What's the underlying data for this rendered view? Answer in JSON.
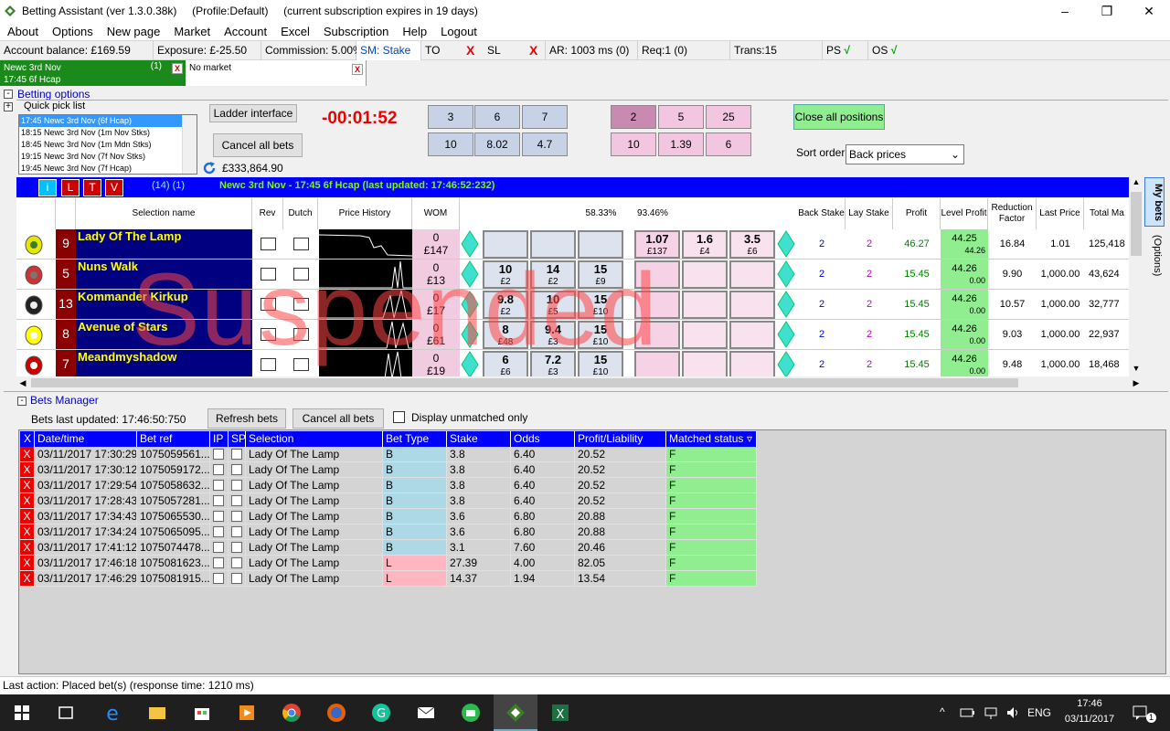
{
  "window": {
    "title": "Betting Assistant (ver 1.3.0.38k)     (Profile:Default)     (current subscription expires in 19 days)",
    "controls": [
      "–",
      "❐",
      "✕"
    ]
  },
  "menu": [
    "About",
    "Options",
    "New page",
    "Market",
    "Account",
    "Excel",
    "Subscription",
    "Help",
    "Logout"
  ],
  "status": {
    "balance": "Account balance: £169.59",
    "exposure": "Exposure: £-25.50",
    "commission": "Commission: 5.00%",
    "sm": "SM: Stake",
    "to": "TO",
    "sl": "SL",
    "x": "X",
    "ar": "AR: 1003 ms (0)",
    "req": "Req:1 (0)",
    "trans": "Trans:15",
    "ps": "PS",
    "os": "OS",
    "check": "√"
  },
  "market_tabs": [
    {
      "line1": "Newc 3rd Nov",
      "line2": "17:45 6f Hcap",
      "count": "(1)",
      "close": "X"
    },
    {
      "line1": "No market",
      "line2": "",
      "count": "",
      "close": "X"
    }
  ],
  "betting_options": {
    "label": "Betting options",
    "quick_pick_label": "Quick pick list",
    "quick_pick": [
      "17:45 Newc 3rd Nov (6f Hcap)",
      "18:15 Newc 3rd Nov (1m Nov Stks)",
      "18:45 Newc 3rd Nov (1m Mdn Stks)",
      "19:15 Newc 3rd Nov (7f Nov Stks)",
      "19:45 Newc 3rd Nov (7f Hcap)"
    ],
    "ladder_btn": "Ladder interface",
    "cancel_all_btn": "Cancel all bets",
    "timer": "-00:01:52",
    "total_matched": "£333,864.90",
    "back_stakes": [
      "3",
      "6",
      "7",
      "10",
      "8.02",
      "4.7"
    ],
    "lay_stakes": [
      "2",
      "5",
      "25",
      "10",
      "1.39",
      "6"
    ],
    "close_all_btn": "Close all positions",
    "sort_label": "Sort order",
    "sort_value": "Back prices"
  },
  "market_bar": {
    "buttons": [
      "i",
      "L",
      "T",
      "V"
    ],
    "count": "(14) (1)",
    "title": "Newc 3rd Nov - 17:45 6f Hcap (last updated: 17:46:52:232)"
  },
  "grid_headers": {
    "selection": "Selection name",
    "rev": "Rev",
    "dutch": "Dutch",
    "price_history": "Price History",
    "wom": "WOM",
    "back_pct": "58.33%",
    "lay_pct": "93.46%",
    "back_stake": "Back Stake",
    "lay_stake": "Lay Stake",
    "profit": "Profit",
    "level_profit": "Level Profit",
    "reduction": "Reduction Factor",
    "last_price": "Last Price",
    "total_matched": "Total Ma"
  },
  "runners": [
    {
      "num": "9",
      "name": "Lady Of The Lamp",
      "wom_top": "0",
      "wom_bot": "£147",
      "back": [
        {
          "p": "",
          "s": ""
        },
        {
          "p": "",
          "s": ""
        },
        {
          "p": "",
          "s": ""
        }
      ],
      "lay": [
        {
          "p": "1.07",
          "s": "£137"
        },
        {
          "p": "1.6",
          "s": "£4"
        },
        {
          "p": "3.5",
          "s": "£6"
        }
      ],
      "back_stake": "2",
      "lay_stake": "2",
      "profit": "46.27",
      "level": "44.25",
      "level_sub": "44.26",
      "reduction": "16.84",
      "last": "1.01",
      "total": "125,418"
    },
    {
      "num": "5",
      "name": "Nuns Walk",
      "wom_top": "0",
      "wom_bot": "£13",
      "back": [
        {
          "p": "10",
          "s": "£2"
        },
        {
          "p": "14",
          "s": "£2"
        },
        {
          "p": "15",
          "s": "£9"
        }
      ],
      "lay": [
        {
          "p": "",
          "s": ""
        },
        {
          "p": "",
          "s": ""
        },
        {
          "p": "",
          "s": ""
        }
      ],
      "back_stake": "2",
      "lay_stake": "2",
      "profit": "15.45",
      "level": "44.26",
      "level_sub": "0.00",
      "reduction": "9.90",
      "last": "1,000.00",
      "total": "43,624"
    },
    {
      "num": "13",
      "name": "Kommander Kirkup",
      "wom_top": "0",
      "wom_bot": "£17",
      "back": [
        {
          "p": "9.8",
          "s": "£2"
        },
        {
          "p": "10",
          "s": "£5"
        },
        {
          "p": "15",
          "s": "£10"
        }
      ],
      "lay": [
        {
          "p": "",
          "s": ""
        },
        {
          "p": "",
          "s": ""
        },
        {
          "p": "",
          "s": ""
        }
      ],
      "back_stake": "2",
      "lay_stake": "2",
      "profit": "15.45",
      "level": "44.26",
      "level_sub": "0.00",
      "reduction": "10.57",
      "last": "1,000.00",
      "total": "32,777"
    },
    {
      "num": "8",
      "name": "Avenue of Stars",
      "wom_top": "0",
      "wom_bot": "£61",
      "back": [
        {
          "p": "8",
          "s": "£48"
        },
        {
          "p": "9.4",
          "s": "£3"
        },
        {
          "p": "15",
          "s": "£10"
        }
      ],
      "lay": [
        {
          "p": "",
          "s": ""
        },
        {
          "p": "",
          "s": ""
        },
        {
          "p": "",
          "s": ""
        }
      ],
      "back_stake": "2",
      "lay_stake": "2",
      "profit": "15.45",
      "level": "44.26",
      "level_sub": "0.00",
      "reduction": "9.03",
      "last": "1,000.00",
      "total": "22,937"
    },
    {
      "num": "7",
      "name": "Meandmyshadow",
      "wom_top": "0",
      "wom_bot": "£19",
      "back": [
        {
          "p": "6",
          "s": "£6"
        },
        {
          "p": "7.2",
          "s": "£3"
        },
        {
          "p": "15",
          "s": "£10"
        }
      ],
      "lay": [
        {
          "p": "",
          "s": ""
        },
        {
          "p": "",
          "s": ""
        },
        {
          "p": "",
          "s": ""
        }
      ],
      "back_stake": "2",
      "lay_stake": "2",
      "profit": "15.45",
      "level": "44.26",
      "level_sub": "0.00",
      "reduction": "9.48",
      "last": "1,000.00",
      "total": "18,468"
    }
  ],
  "suspended": "Suspended",
  "side_tabs": {
    "my_bets": "My bets",
    "options": "(Options)"
  },
  "bets_manager": {
    "label": "Bets Manager",
    "last_updated": "Bets last updated: 17:46:50:750",
    "refresh_btn": "Refresh bets",
    "cancel_btn": "Cancel all bets",
    "unmatched_label": "Display unmatched only",
    "columns": [
      "X",
      "Date/time",
      "Bet ref",
      "IP",
      "SP",
      "Selection",
      "Bet Type",
      "Stake",
      "Odds",
      "Profit/Liability",
      "Matched status"
    ],
    "sort_arrow": "▿",
    "rows": [
      {
        "dt": "03/11/2017 17:30:29",
        "ref": "1075059561...",
        "sel": "Lady Of The Lamp",
        "type": "B",
        "stake": "3.8",
        "odds": "6.40",
        "pl": "20.52",
        "status": "F"
      },
      {
        "dt": "03/11/2017 17:30:12",
        "ref": "1075059172...",
        "sel": "Lady Of The Lamp",
        "type": "B",
        "stake": "3.8",
        "odds": "6.40",
        "pl": "20.52",
        "status": "F"
      },
      {
        "dt": "03/11/2017 17:29:54",
        "ref": "1075058632...",
        "sel": "Lady Of The Lamp",
        "type": "B",
        "stake": "3.8",
        "odds": "6.40",
        "pl": "20.52",
        "status": "F"
      },
      {
        "dt": "03/11/2017 17:28:43",
        "ref": "1075057281...",
        "sel": "Lady Of The Lamp",
        "type": "B",
        "stake": "3.8",
        "odds": "6.40",
        "pl": "20.52",
        "status": "F"
      },
      {
        "dt": "03/11/2017 17:34:43",
        "ref": "1075065530...",
        "sel": "Lady Of The Lamp",
        "type": "B",
        "stake": "3.6",
        "odds": "6.80",
        "pl": "20.88",
        "status": "F"
      },
      {
        "dt": "03/11/2017 17:34:24",
        "ref": "1075065095...",
        "sel": "Lady Of The Lamp",
        "type": "B",
        "stake": "3.6",
        "odds": "6.80",
        "pl": "20.88",
        "status": "F"
      },
      {
        "dt": "03/11/2017 17:41:12",
        "ref": "1075074478...",
        "sel": "Lady Of The Lamp",
        "type": "B",
        "stake": "3.1",
        "odds": "7.60",
        "pl": "20.46",
        "status": "F"
      },
      {
        "dt": "03/11/2017 17:46:18",
        "ref": "1075081623...",
        "sel": "Lady Of The Lamp",
        "type": "L",
        "stake": "27.39",
        "odds": "4.00",
        "pl": "82.05",
        "status": "F"
      },
      {
        "dt": "03/11/2017 17:46:29",
        "ref": "1075081915...",
        "sel": "Lady Of The Lamp",
        "type": "L",
        "stake": "14.37",
        "odds": "1.94",
        "pl": "13.54",
        "status": "F"
      }
    ]
  },
  "last_action": "Last action: Placed bet(s) (response time: 1210 ms)",
  "taskbar": {
    "lang": "ENG",
    "time": "17:46",
    "date": "03/11/2017",
    "caret": "^",
    "notif": "1"
  }
}
